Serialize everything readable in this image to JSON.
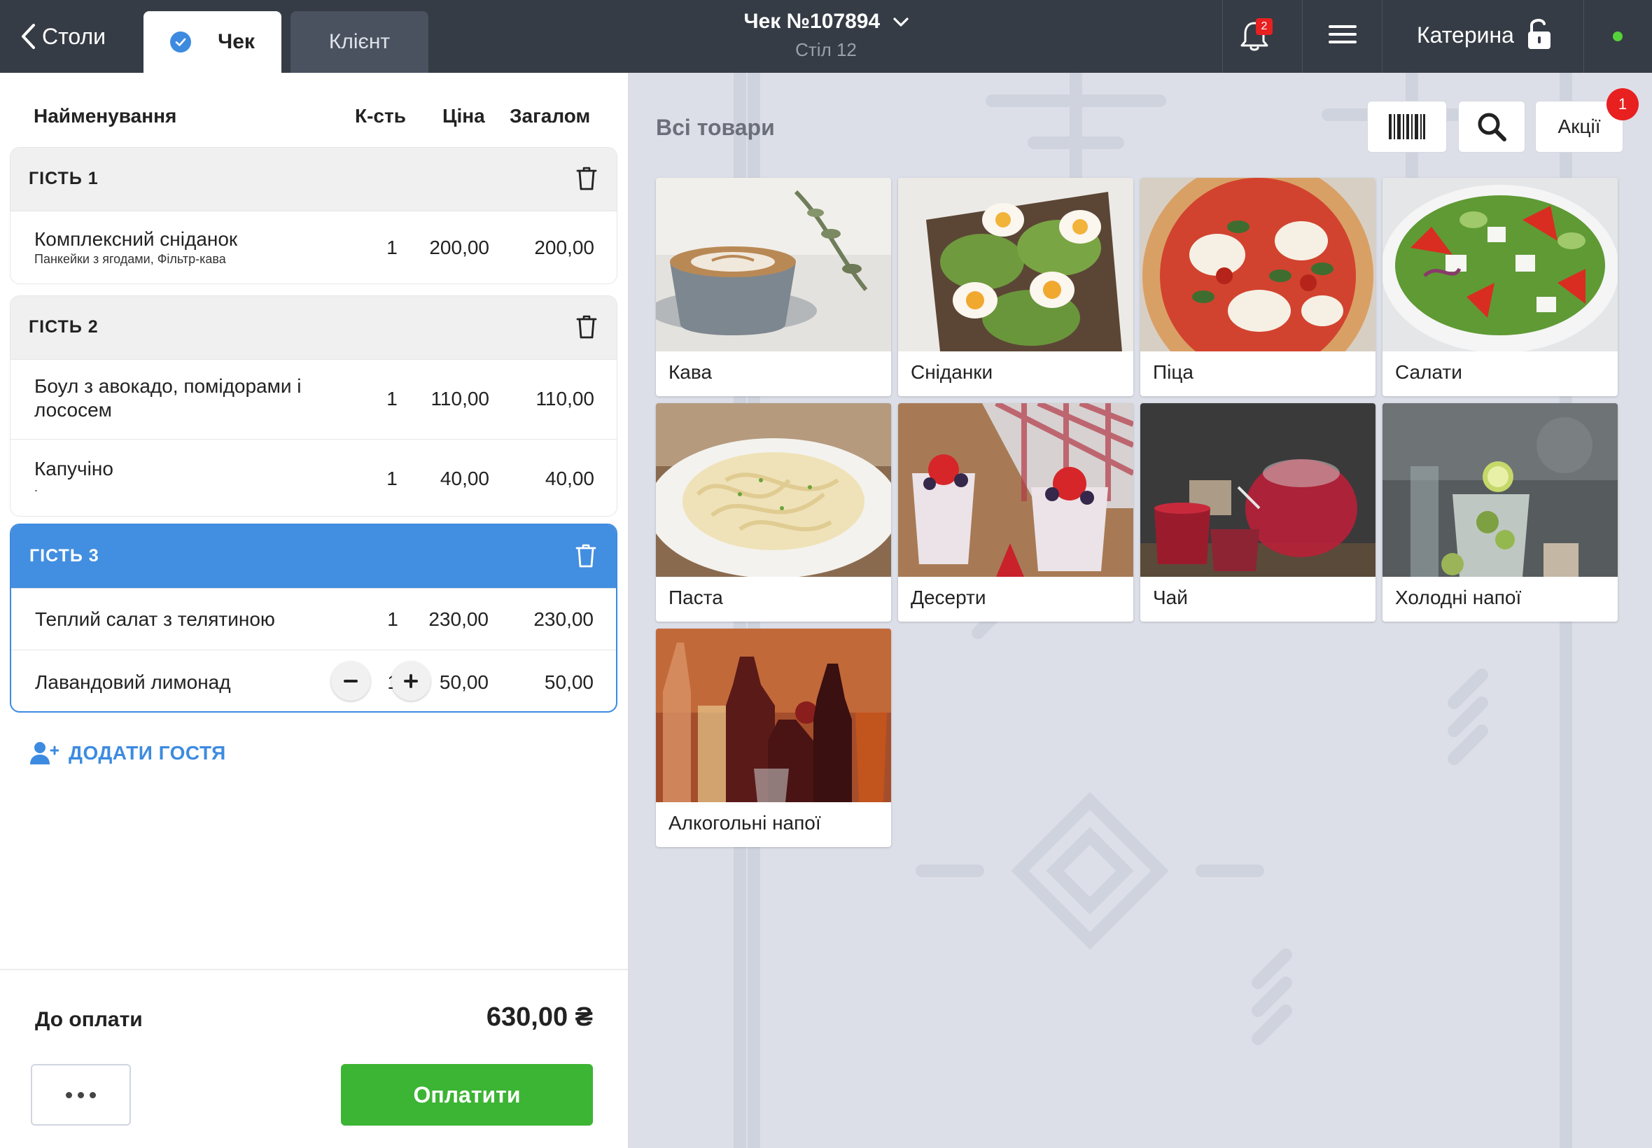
{
  "topbar": {
    "back_label": "Столи",
    "tabs": [
      {
        "label": "Чек",
        "active": true
      },
      {
        "label": "Клієнт",
        "active": false
      }
    ],
    "order_number": "Чек №107894",
    "table": "Стіл 12",
    "notifications_count": "2",
    "user_name": "Катерина",
    "status_color": "#55d23a"
  },
  "columns": {
    "name": "Найменування",
    "qty": "К-сть",
    "price": "Ціна",
    "total": "Загалом"
  },
  "guests": [
    {
      "name": "ГІСТЬ 1",
      "active": false,
      "items": [
        {
          "name": "Комплексний сніданок",
          "sub": "Панкейки з ягодами, Фільтр-кава",
          "qty": "1",
          "price": "200,00",
          "total": "200,00"
        }
      ]
    },
    {
      "name": "ГІСТЬ 2",
      "active": false,
      "items": [
        {
          "name_line1": "Боул з авокадо, помідорами і",
          "name_line2": "лососем",
          "qty": "1",
          "price": "110,00",
          "total": "110,00"
        },
        {
          "name": "Капучіно",
          "sub": ".",
          "qty": "1",
          "price": "40,00",
          "total": "40,00"
        }
      ]
    },
    {
      "name": "ГІСТЬ 3",
      "active": true,
      "items": [
        {
          "name": "Теплий салат з телятиною",
          "qty": "1",
          "price": "230,00",
          "total": "230,00"
        },
        {
          "name": "Лавандовий лимонад",
          "qty": "1",
          "price": "50,00",
          "total": "50,00",
          "stepper": true
        }
      ]
    }
  ],
  "add_guest_label": "ДОДАТИ ГОСТЯ",
  "footer": {
    "pay_label": "До оплати",
    "pay_amount": "630,00 ₴",
    "pay_button": "Оплатити"
  },
  "catalog": {
    "title": "Всі товари",
    "promo_label": "Акції",
    "promo_count": "1",
    "categories": [
      {
        "label": "Кава",
        "icon": "coffee-image"
      },
      {
        "label": "Сніданки",
        "icon": "breakfast-image"
      },
      {
        "label": "Піца",
        "icon": "pizza-image"
      },
      {
        "label": "Салати",
        "icon": "salad-image"
      },
      {
        "label": "Паста",
        "icon": "pasta-image"
      },
      {
        "label": "Десерти",
        "icon": "dessert-image"
      },
      {
        "label": "Чай",
        "icon": "tea-image"
      },
      {
        "label": "Холодні напої",
        "icon": "cold-drinks-image"
      },
      {
        "label": "Алкогольні напої",
        "icon": "alcohol-image"
      }
    ]
  },
  "colors": {
    "topbar": "#363c45",
    "accent_blue": "#3d8be0",
    "pay_green": "#3cb434",
    "badge_red": "#e82020",
    "catalog_bg": "#dcdfe8"
  }
}
